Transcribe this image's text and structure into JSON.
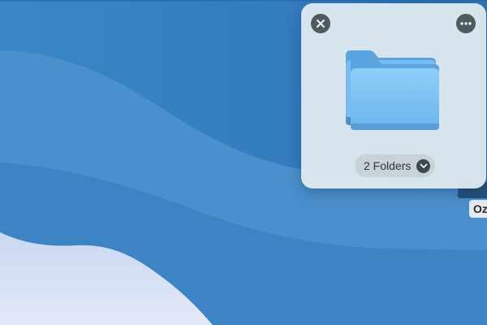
{
  "desktop": {
    "wallpaper": "blue-waves",
    "item_label": "Oz",
    "colors": {
      "base": "#2f77b8",
      "light_wave": "#4a90cc",
      "bottom_light": "#dde5f7"
    }
  },
  "panel": {
    "close_icon": "close-icon",
    "more_icon": "more-icon",
    "folder_icon": "folder-stack-icon",
    "selection_label": "2 Folders",
    "chevron_icon": "chevron-down-icon",
    "colors": {
      "background": "#dde8ee",
      "button": "#4f5a5f",
      "folder": "#6fb8f0"
    }
  }
}
